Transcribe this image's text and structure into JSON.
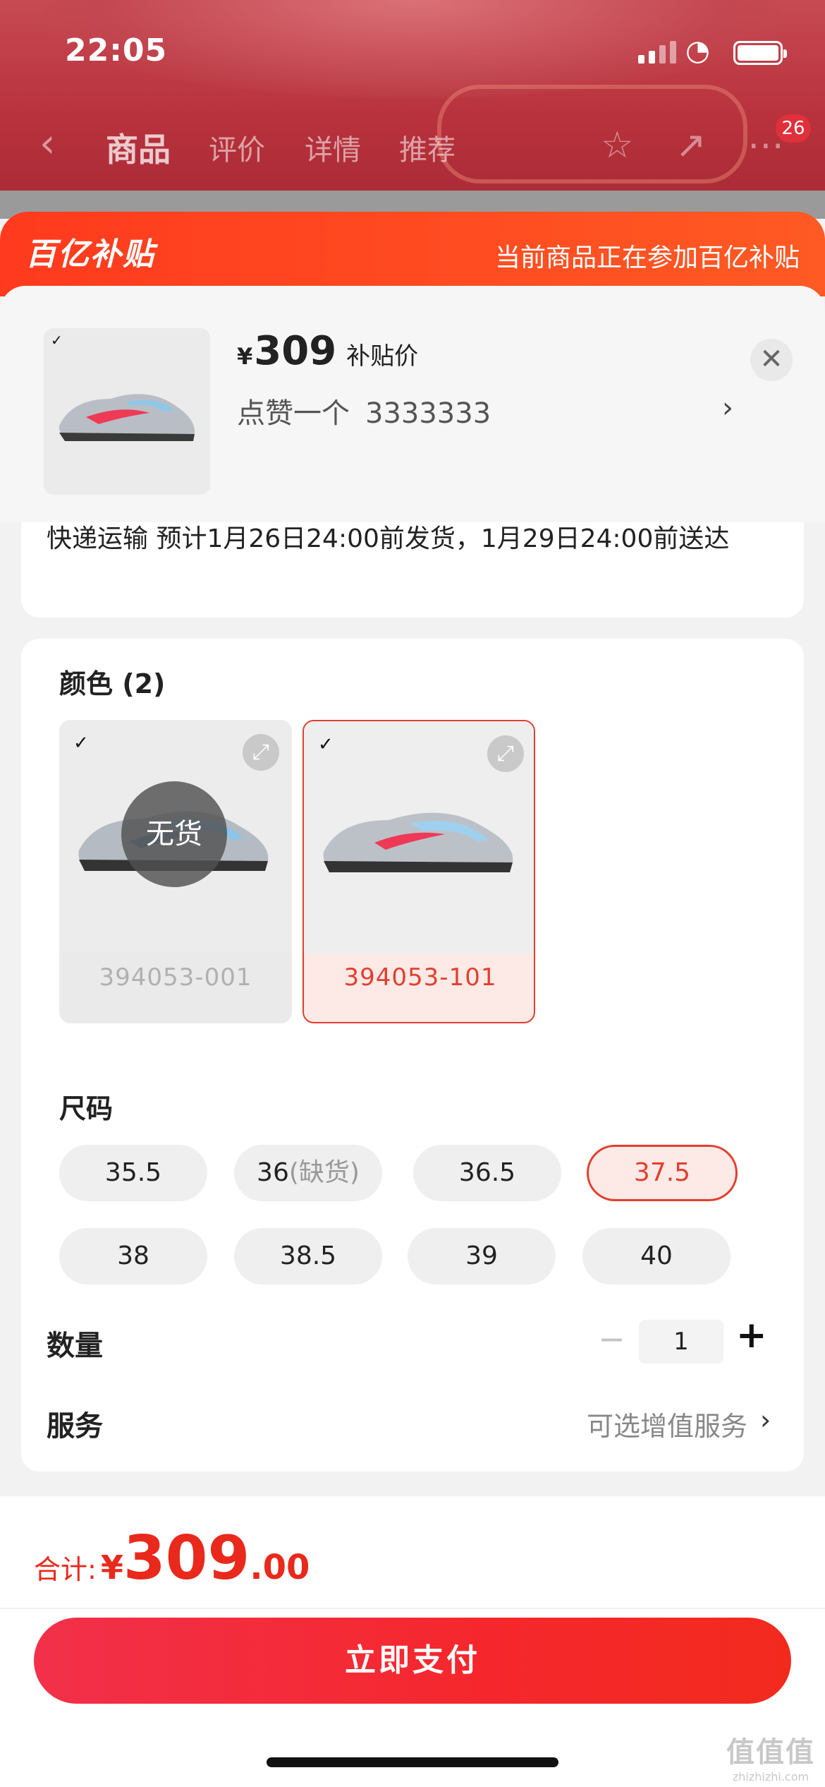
{
  "status_bar": {
    "time": "22:05"
  },
  "nav": {
    "tabs": [
      "商品",
      "评价",
      "详情",
      "推荐"
    ],
    "cart_badge": "26"
  },
  "banner": {
    "logo": "百亿补贴",
    "note": "当前商品正在参加百亿补贴"
  },
  "product": {
    "currency": "¥",
    "price": "309",
    "price_label": "补贴价",
    "like_text": "点赞一个",
    "like_code": "3333333"
  },
  "delivery": {
    "text": "快递运输 预计1月26日24:00前发货，1月29日24:00前送达"
  },
  "color_section": {
    "title": "颜色 (2)",
    "options": [
      {
        "code": "394053-001",
        "status": "无货",
        "selected": false
      },
      {
        "code": "394053-101",
        "status": "",
        "selected": true
      }
    ]
  },
  "size_section": {
    "title": "尺码",
    "sizes": [
      {
        "label": "35.5",
        "note": "",
        "selected": false
      },
      {
        "label": "36",
        "note": "(缺货)",
        "selected": false
      },
      {
        "label": "36.5",
        "note": "",
        "selected": false
      },
      {
        "label": "37.5",
        "note": "",
        "selected": true
      },
      {
        "label": "38",
        "note": "",
        "selected": false
      },
      {
        "label": "38.5",
        "note": "",
        "selected": false
      },
      {
        "label": "39",
        "note": "",
        "selected": false
      },
      {
        "label": "40",
        "note": "",
        "selected": false
      }
    ]
  },
  "quantity": {
    "label": "数量",
    "value": "1",
    "minus": "−",
    "plus": "+"
  },
  "service": {
    "label": "服务",
    "value": "可选增值服务"
  },
  "summary": {
    "label": "合计:",
    "currency": "¥",
    "amount_int": "309",
    "amount_dec": ".00"
  },
  "pay_button": {
    "label": "立即支付"
  },
  "watermark": {
    "big": "值值值",
    "small": "zhizhizhi.com"
  },
  "colors": {
    "accent": "#e0402e",
    "banner": "#ff4a20",
    "pay": "#f5272c"
  }
}
